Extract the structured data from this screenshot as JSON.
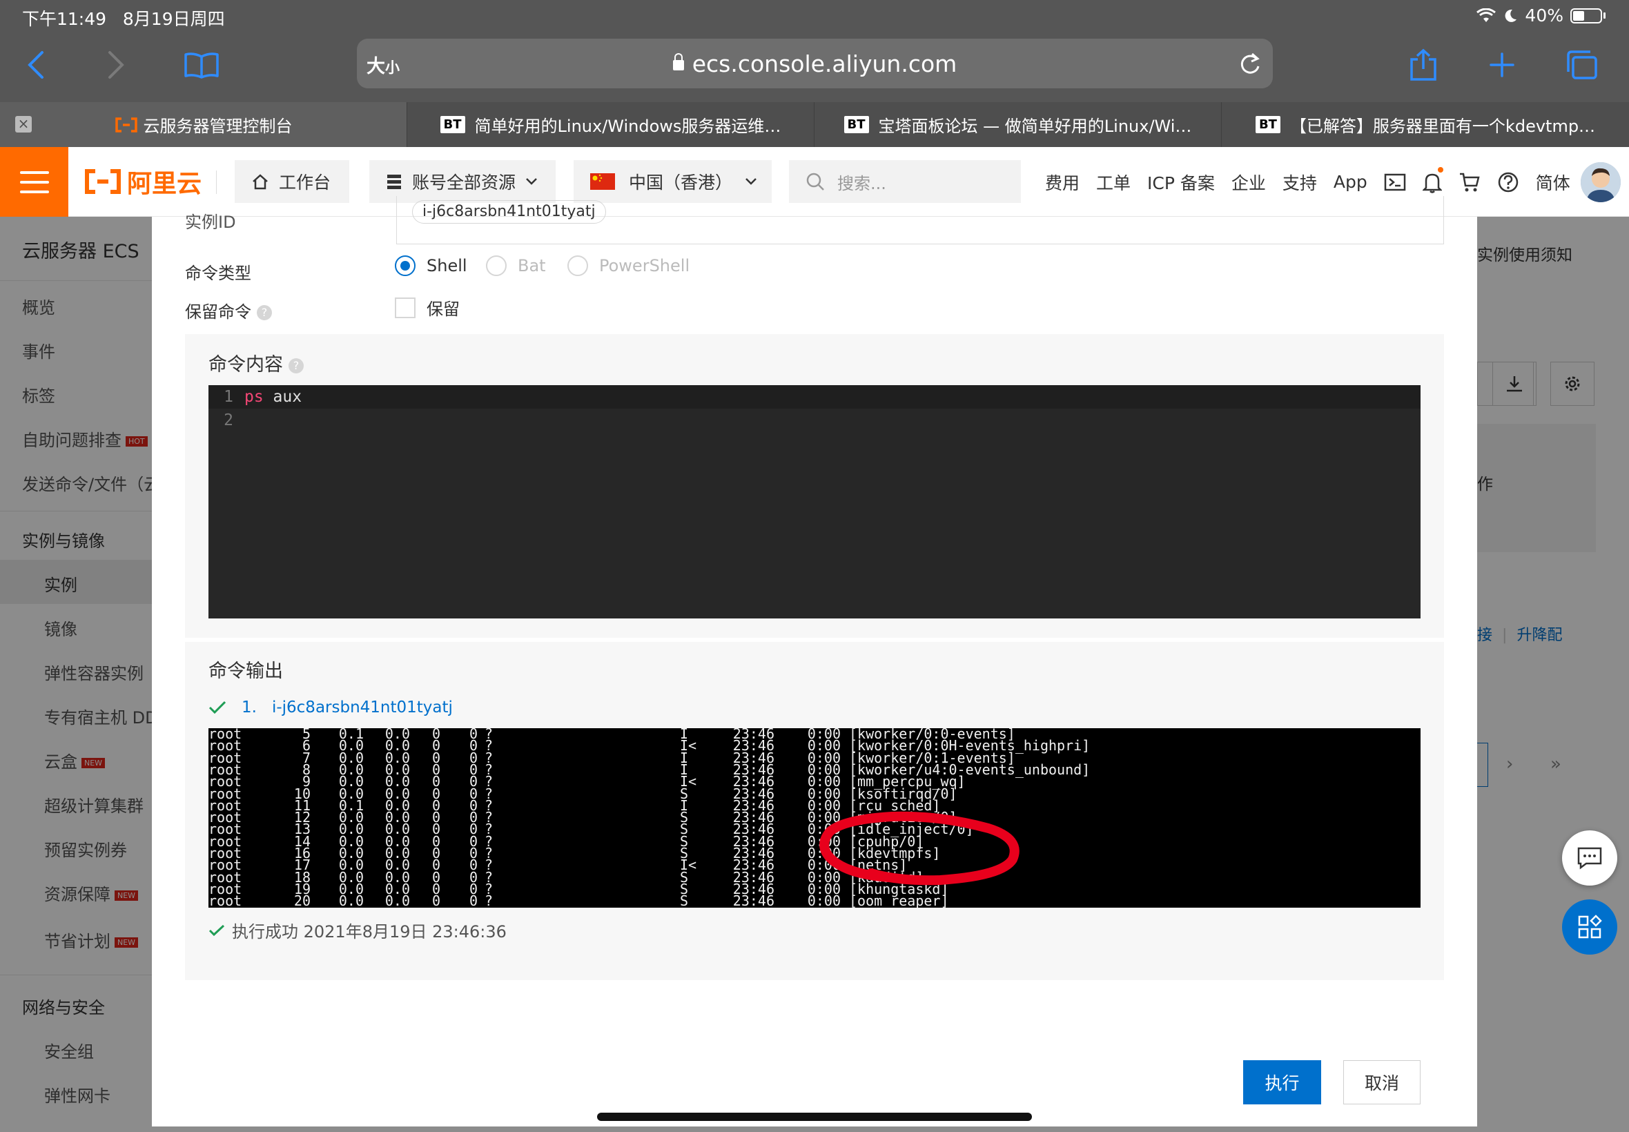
{
  "status_bar": {
    "time": "下午11:49",
    "date": "8月19日周四",
    "battery": "40%"
  },
  "browser": {
    "text_size_label": "大",
    "text_size_small": "小",
    "url": "ecs.console.aliyun.com",
    "tabs": [
      {
        "label": "云服务器管理控制台",
        "badge": ""
      },
      {
        "label": "简单好用的Linux/Windows服务器运维…",
        "badge": "BT"
      },
      {
        "label": "宝塔面板论坛 — 做简单好用的Linux/Wi…",
        "badge": "BT"
      },
      {
        "label": "【已解答】服务器里面有一个kdevtmp…",
        "badge": "BT"
      }
    ]
  },
  "topbar": {
    "logo_text": "阿里云",
    "workbench": "工作台",
    "resources": "账号全部资源",
    "region": "中国（香港）",
    "search_placeholder": "搜索...",
    "links": [
      "费用",
      "工单",
      "ICP 备案",
      "企业",
      "支持",
      "App"
    ],
    "language": "简体"
  },
  "sidebar": {
    "title": "云服务器 ECS",
    "items_top": [
      "概览",
      "事件",
      "标签",
      "自助问题排查",
      "发送命令/文件（云"
    ],
    "hot_badge": "HOT",
    "section_instances": "实例与镜像",
    "items_instances": [
      "实例",
      "镜像",
      "弹性容器实例",
      "专有宿主机 DD",
      "云盒",
      "超级计算集群",
      "预留实例券",
      "资源保障",
      "节省计划"
    ],
    "new_badge": "NEW",
    "section_network": "网络与安全",
    "items_network": [
      "安全组",
      "弹性网卡"
    ]
  },
  "right_peek": {
    "notice": "实例使用须知",
    "action_fragment": "作",
    "link_fragment": "接",
    "upgrade": "升降配"
  },
  "modal": {
    "instance_label": "实例ID",
    "instance_value": "i-j6c8arsbn41nt01tyatj",
    "command_type_label": "命令类型",
    "command_types": [
      "Shell",
      "Bat",
      "PowerShell"
    ],
    "keep_command_label": "保留命令",
    "keep_checkbox_label": "保留",
    "content_title": "命令内容",
    "code_lines": [
      {
        "no": "1",
        "cmd": "ps",
        "args": " aux"
      },
      {
        "no": "2",
        "cmd": "",
        "args": ""
      }
    ],
    "output_title": "命令输出",
    "output_index": "1.",
    "output_instance": "i-j6c8arsbn41nt01tyatj",
    "output_rows": [
      [
        "root",
        "5",
        "0.1",
        "0.0",
        "0",
        "0",
        "?",
        "I",
        "23:46",
        "0:00",
        "[kworker/0:0-events]"
      ],
      [
        "root",
        "6",
        "0.0",
        "0.0",
        "0",
        "0",
        "?",
        "I<",
        "23:46",
        "0:00",
        "[kworker/0:0H-events_highpri]"
      ],
      [
        "root",
        "7",
        "0.0",
        "0.0",
        "0",
        "0",
        "?",
        "I",
        "23:46",
        "0:00",
        "[kworker/0:1-events]"
      ],
      [
        "root",
        "8",
        "0.0",
        "0.0",
        "0",
        "0",
        "?",
        "I",
        "23:46",
        "0:00",
        "[kworker/u4:0-events_unbound]"
      ],
      [
        "root",
        "9",
        "0.0",
        "0.0",
        "0",
        "0",
        "?",
        "I<",
        "23:46",
        "0:00",
        "[mm_percpu_wq]"
      ],
      [
        "root",
        "10",
        "0.0",
        "0.0",
        "0",
        "0",
        "?",
        "S",
        "23:46",
        "0:00",
        "[ksoftirqd/0]"
      ],
      [
        "root",
        "11",
        "0.1",
        "0.0",
        "0",
        "0",
        "?",
        "I",
        "23:46",
        "0:00",
        "[rcu_sched]"
      ],
      [
        "root",
        "12",
        "0.0",
        "0.0",
        "0",
        "0",
        "?",
        "S",
        "23:46",
        "0:00",
        "[migration/0]"
      ],
      [
        "root",
        "13",
        "0.0",
        "0.0",
        "0",
        "0",
        "?",
        "S",
        "23:46",
        "0:00",
        "[idle_inject/0]"
      ],
      [
        "root",
        "14",
        "0.0",
        "0.0",
        "0",
        "0",
        "?",
        "S",
        "23:46",
        "0:00",
        "[cpuhp/0]"
      ],
      [
        "root",
        "16",
        "0.0",
        "0.0",
        "0",
        "0",
        "?",
        "S",
        "23:46",
        "0:00",
        "[kdevtmpfs]"
      ],
      [
        "root",
        "17",
        "0.0",
        "0.0",
        "0",
        "0",
        "?",
        "I<",
        "23:46",
        "0:00",
        "[netns]"
      ],
      [
        "root",
        "18",
        "0.0",
        "0.0",
        "0",
        "0",
        "?",
        "S",
        "23:46",
        "0:00",
        "[kauditd]"
      ],
      [
        "root",
        "19",
        "0.0",
        "0.0",
        "0",
        "0",
        "?",
        "S",
        "23:46",
        "0:00",
        "[khungtaskd]"
      ],
      [
        "root",
        "20",
        "0.0",
        "0.0",
        "0",
        "0",
        "?",
        "S",
        "23:46",
        "0:00",
        "[oom_reaper]"
      ]
    ],
    "success_text": "执行成功 2021年8月19日 23:46:36",
    "run_button": "执行",
    "cancel_button": "取消"
  },
  "colors": {
    "brand_orange": "#ff6a00",
    "primary_blue": "#0070cc",
    "annotation_red": "#e8001c"
  }
}
